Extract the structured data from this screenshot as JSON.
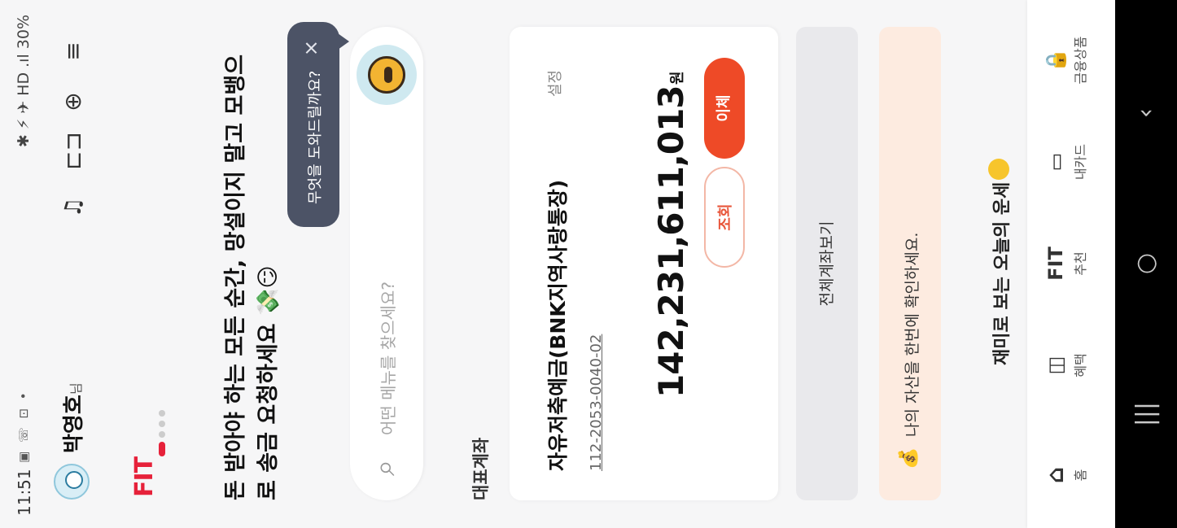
{
  "status_bar": {
    "time": "11:51",
    "left_icons": "▣ ☏ ⊡ •",
    "right_text": "✱ ⚡ ✈ HD .ıl 30%"
  },
  "header": {
    "username": "박영호",
    "username_suffix": "님",
    "bell_icon": "♫",
    "scan_icon": "⊏⊐",
    "search_icon": "⊕",
    "menu_icon": "≡"
  },
  "banner": {
    "logo": "FIT",
    "headline": "돈 받아야 하는 모든 순간, 망설이지 말고 모뱅으로 송금 요청하세요 💸😏"
  },
  "tooltip": {
    "text": "무엇을 도와드릴까요?",
    "close": "×"
  },
  "search": {
    "placeholder": "어떤 메뉴를 찾으세요?"
  },
  "accounts": {
    "section_title": "대표계좌",
    "account_name": "자유저축예금(BNK지역사랑통장)",
    "account_number": "112-2053-0040-02",
    "settings_label": "설정",
    "balance": "142,231,611,013",
    "currency": "원",
    "inquiry_label": "조회",
    "transfer_label": "이체"
  },
  "view_all_label": "전체계좌보기",
  "asset_banner": {
    "icon": "💰",
    "text": "나의 자산을 한번에 확인하세요."
  },
  "fortune": {
    "text": "재미로 보는 오늘의 운세"
  },
  "bottom_nav": {
    "items": [
      {
        "icon": "⌂",
        "label": "홈"
      },
      {
        "icon": "◫",
        "label": "혜택"
      },
      {
        "icon": "FIT",
        "label": "추천"
      },
      {
        "icon": "▭",
        "label": "내카드"
      },
      {
        "icon": "🔒",
        "label": "금융상품"
      }
    ]
  },
  "system_nav": {
    "recent": "|||",
    "home": "○",
    "back": "‹"
  }
}
